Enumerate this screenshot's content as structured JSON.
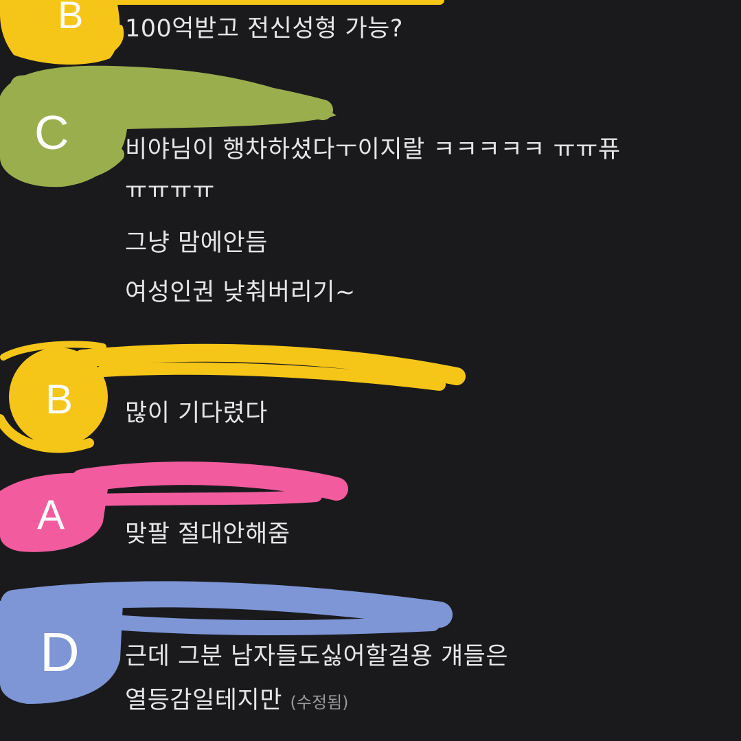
{
  "comments": [
    {
      "avatar_letter": "B",
      "avatar_color": "#f5c518",
      "lines": [
        "100억받고 전신성형 가능?"
      ]
    },
    {
      "avatar_letter": "C",
      "avatar_color": "#9aae4e",
      "lines": [
        "비야님이 행차하셨다ㅜ이지랄 ㅋㅋㅋㅋㅋ ㅠㅠ퓨",
        "ㅠㅠㅠㅠ",
        "그냥 맘에안듬",
        "여성인권 낮춰버리기~"
      ]
    },
    {
      "avatar_letter": "B",
      "avatar_color": "#f5c518",
      "lines": [
        "많이 기다렸다"
      ]
    },
    {
      "avatar_letter": "A",
      "avatar_color": "#f25c9e",
      "lines": [
        "맞팔 절대안해줌"
      ]
    },
    {
      "avatar_letter": "D",
      "avatar_color": "#7e96d6",
      "lines": [
        "근데 그분 남자들도싫어할걸용 걔들은",
        "열등감일테지만"
      ],
      "edited_label": "(수정됨)"
    }
  ]
}
